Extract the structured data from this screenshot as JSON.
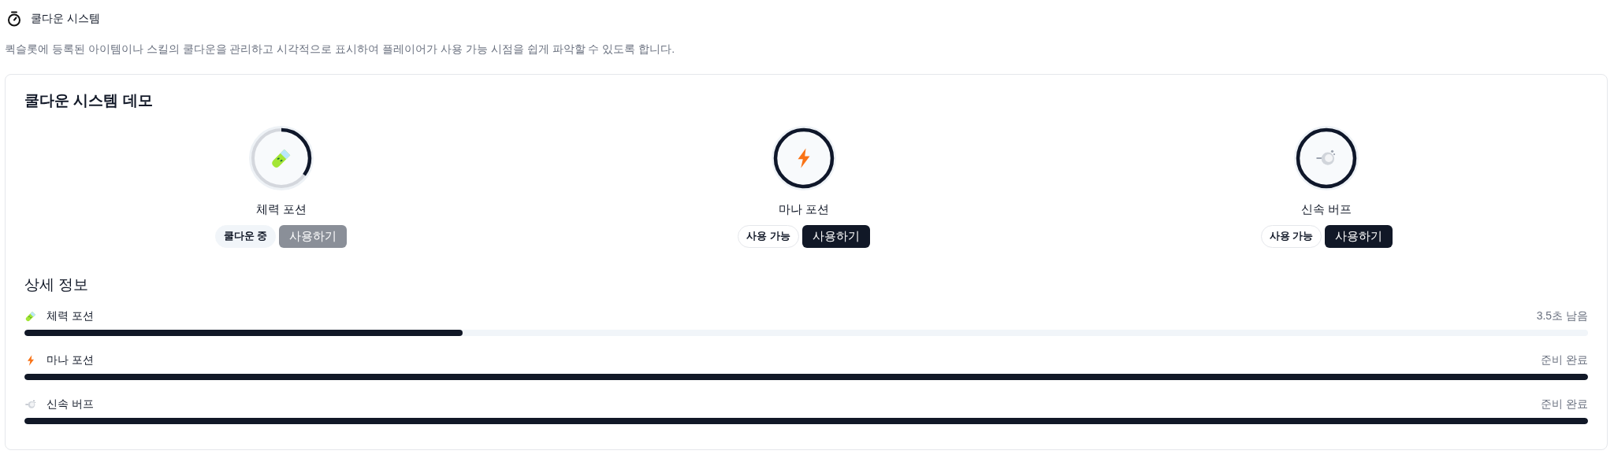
{
  "header": {
    "title": "쿨다운 시스템",
    "description": "퀵슬롯에 등록된 아이템이나 스킬의 쿨다운을 관리하고 시각적으로 표시하여 플레이어가 사용 가능 시점을 쉽게 파악할 수 있도록 합니다."
  },
  "demo": {
    "title": "쿨다운 시스템 데모",
    "skills": [
      {
        "kind": "potion",
        "name": "체력 포션",
        "cooling": true,
        "status": "쿨다운 중",
        "button": "사용하기"
      },
      {
        "kind": "bolt",
        "name": "마나 포션",
        "cooling": false,
        "status": "사용 가능",
        "button": "사용하기"
      },
      {
        "kind": "cloud",
        "name": "신속 버프",
        "cooling": false,
        "status": "사용 가능",
        "button": "사용하기"
      }
    ],
    "details_title": "상세 정보",
    "details": [
      {
        "kind": "potion",
        "name": "체력 포션",
        "reading": "3.5초 남음",
        "level": 0.28
      },
      {
        "kind": "bolt",
        "name": "마나 포션",
        "reading": "준비 완료",
        "level": 1
      },
      {
        "kind": "cloud",
        "name": "신속 버프",
        "reading": "준비 완료",
        "level": 1
      }
    ]
  }
}
